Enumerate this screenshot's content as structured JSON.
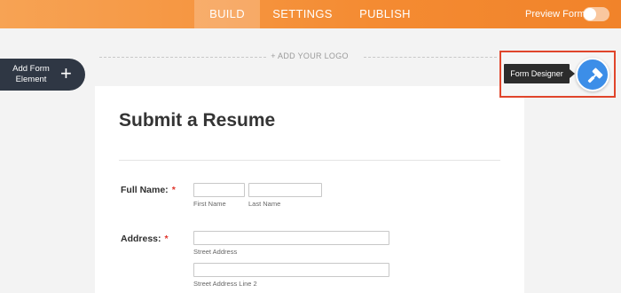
{
  "topbar": {
    "tabs": [
      {
        "label": "BUILD",
        "active": true
      },
      {
        "label": "SETTINGS",
        "active": false
      },
      {
        "label": "PUBLISH",
        "active": false
      }
    ],
    "preview_label": "Preview Form",
    "preview_enabled": false,
    "gradient_colors": [
      "#f7a354",
      "#f1832a"
    ]
  },
  "logo": {
    "placeholder": "+ ADD YOUR LOGO"
  },
  "sidebar": {
    "add_element_label": "Add Form Element",
    "add_icon": "plus-icon"
  },
  "designer": {
    "tooltip": "Form Designer",
    "icon": "paint-roller-icon",
    "button_color": "#3c8ee8",
    "highlight_color": "#e0452b"
  },
  "form": {
    "title": "Submit a Resume",
    "fields": {
      "full_name": {
        "label": "Full Name:",
        "required_mark": "*",
        "first_sublabel": "First Name",
        "last_sublabel": "Last Name"
      },
      "address": {
        "label": "Address:",
        "required_mark": "*",
        "street_sublabel": "Street Address",
        "street2_sublabel": "Street Address Line 2"
      }
    }
  }
}
